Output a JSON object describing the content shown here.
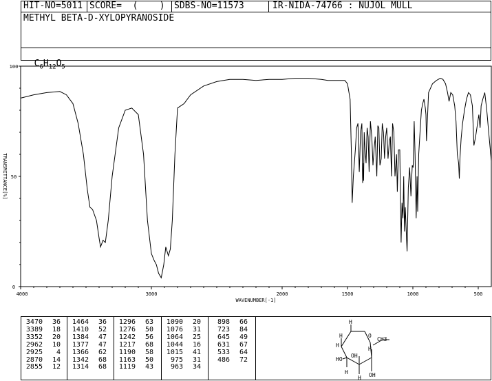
{
  "header": {
    "hit_no": "HIT-NO=5011",
    "score": "SCORE=  (    )",
    "sdbs_no": "SDBS-NO=11573",
    "ir_nida": "IR-NIDA-74766 : NUJOL MULL",
    "compound": "METHYL BETA-D-XYLOPYRANOSIDE",
    "formula_c": "C",
    "formula_c_sub": "6",
    "formula_h": "H",
    "formula_h_sub": "12",
    "formula_o": "O",
    "formula_o_sub": "5"
  },
  "chart_data": {
    "type": "line",
    "xlabel": "WAVENUMBER[-1]",
    "ylabel": "TRANSMITTANCE[%]",
    "xlim": [
      4000,
      400
    ],
    "ylim": [
      0,
      100
    ],
    "x_ticks": [
      4000,
      3000,
      2000,
      1500,
      1000,
      500
    ],
    "y_ticks": [
      0,
      50,
      100
    ],
    "x_tick_labels": [
      "4000",
      "3000",
      "2000",
      "1500",
      "1000",
      "500"
    ],
    "y_tick_labels": [
      "0",
      "50",
      "100"
    ],
    "grid": false,
    "series": [
      {
        "x": [
          4000,
          3900,
          3800,
          3700,
          3650,
          3600,
          3560,
          3520,
          3490,
          3470,
          3450,
          3420,
          3400,
          3389,
          3370,
          3352,
          3330,
          3300,
          3250,
          3200,
          3150,
          3100,
          3060,
          3030,
          3000,
          2980,
          2962,
          2945,
          2925,
          2905,
          2890,
          2870,
          2855,
          2840,
          2820,
          2800,
          2750,
          2700,
          2600,
          2500,
          2400,
          2300,
          2200,
          2100,
          2000,
          1900,
          1800,
          1700,
          1650,
          1600,
          1570,
          1550,
          1520,
          1500,
          1480,
          1470,
          1464,
          1455,
          1440,
          1430,
          1420,
          1410,
          1400,
          1390,
          1384,
          1378,
          1377,
          1372,
          1366,
          1358,
          1350,
          1342,
          1335,
          1325,
          1314,
          1305,
          1296,
          1288,
          1276,
          1268,
          1260,
          1252,
          1242,
          1234,
          1225,
          1217,
          1208,
          1200,
          1190,
          1180,
          1172,
          1163,
          1155,
          1145,
          1137,
          1125,
          1119,
          1110,
          1100,
          1090,
          1083,
          1076,
          1070,
          1064,
          1058,
          1050,
          1044,
          1035,
          1025,
          1015,
          1005,
          998,
          990,
          983,
          975,
          968,
          963,
          955,
          945,
          935,
          925,
          915,
          905,
          900,
          896,
          880,
          850,
          820,
          790,
          770,
          750,
          735,
          723,
          710,
          695,
          680,
          670,
          660,
          650,
          645,
          640,
          631,
          620,
          605,
          590,
          575,
          560,
          545,
          533,
          520,
          505,
          495,
          486,
          478,
          465,
          450,
          435,
          420,
          400
        ],
        "y": [
          85.5,
          87,
          88,
          88.5,
          87,
          83,
          74,
          60,
          44,
          36,
          35,
          30,
          22,
          18,
          21,
          20,
          30,
          50,
          72,
          80,
          81,
          78,
          60,
          30,
          15,
          12,
          10,
          6,
          4,
          10,
          18,
          14,
          17,
          30,
          60,
          81,
          83,
          87,
          91,
          93,
          94,
          94,
          93.5,
          94,
          94,
          94.5,
          94.5,
          94,
          93.5,
          93.5,
          93.5,
          93.5,
          93.5,
          92,
          85,
          60,
          38,
          50,
          62,
          72,
          74,
          52,
          70,
          74,
          47,
          56,
          48,
          70,
          62,
          56,
          72,
          68,
          52,
          75,
          68,
          55,
          63,
          68,
          50,
          73,
          72,
          55,
          58,
          74,
          70,
          58,
          68,
          72,
          58,
          66,
          68,
          50,
          74,
          70,
          50,
          60,
          43,
          62,
          62,
          20,
          38,
          31,
          50,
          25,
          36,
          24,
          16,
          45,
          54,
          41,
          55,
          54,
          75,
          60,
          31,
          50,
          34,
          60,
          70,
          80,
          83,
          85,
          81,
          78,
          66,
          88,
          92,
          93.5,
          94.5,
          94,
          92,
          88,
          84,
          88,
          87,
          82,
          75,
          60,
          56,
          49,
          58,
          67,
          74,
          80,
          85,
          88,
          87,
          82,
          64,
          68,
          74,
          78,
          72,
          82,
          85,
          88,
          80,
          70,
          57
        ]
      }
    ]
  },
  "peaks": {
    "col1": [
      [
        "3470",
        "36"
      ],
      [
        "3389",
        "18"
      ],
      [
        "3352",
        "20"
      ],
      [
        "2962",
        "10"
      ],
      [
        "2925",
        "4"
      ],
      [
        "2870",
        "14"
      ],
      [
        "2855",
        "12"
      ]
    ],
    "col2": [
      [
        "1464",
        "36"
      ],
      [
        "1410",
        "52"
      ],
      [
        "1384",
        "47"
      ],
      [
        "1377",
        "47"
      ],
      [
        "1366",
        "62"
      ],
      [
        "1342",
        "68"
      ],
      [
        "1314",
        "68"
      ]
    ],
    "col3": [
      [
        "1296",
        "63"
      ],
      [
        "1276",
        "50"
      ],
      [
        "1242",
        "56"
      ],
      [
        "1217",
        "68"
      ],
      [
        "1190",
        "58"
      ],
      [
        "1163",
        "50"
      ],
      [
        "1119",
        "43"
      ]
    ],
    "col4": [
      [
        "1090",
        "20"
      ],
      [
        "1076",
        "31"
      ],
      [
        "1064",
        "25"
      ],
      [
        "1044",
        "16"
      ],
      [
        "1015",
        "41"
      ],
      [
        "975",
        "31"
      ],
      [
        "963",
        "34"
      ]
    ],
    "col5": [
      [
        "898",
        "66"
      ],
      [
        "723",
        "84"
      ],
      [
        "645",
        "49"
      ],
      [
        "631",
        "67"
      ],
      [
        "533",
        "64"
      ],
      [
        "486",
        "72"
      ]
    ]
  },
  "structure": {
    "labels": [
      "H",
      "O",
      "CH3",
      "H",
      "H",
      "HO",
      "OH",
      "H",
      "H",
      "H",
      "OH"
    ]
  }
}
